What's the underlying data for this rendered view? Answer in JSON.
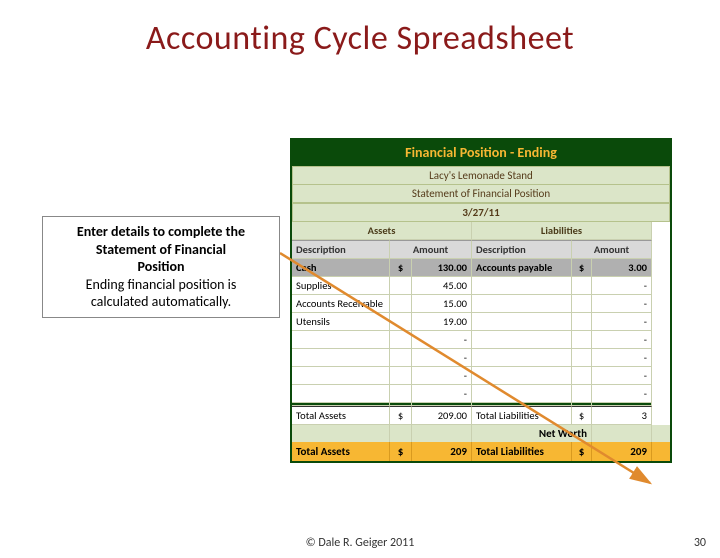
{
  "slide": {
    "title": "Accounting Cycle Spreadsheet",
    "footer": "© Dale R. Geiger 2011",
    "page_number": "30"
  },
  "callout": {
    "line1": "Enter details to complete the",
    "line2": "Statement of Financial",
    "line3": "Position",
    "line4": "Ending financial position is",
    "line5": "calculated automatically."
  },
  "sheet": {
    "banner": "Financial Position - Ending",
    "company": "Lacy's Lemonade Stand",
    "stmt": "Statement of Financial Position",
    "date": "3/27/11",
    "headers": {
      "assets": "Assets",
      "liabilities": "Liabilities",
      "desc": "Description",
      "amount": "Amount"
    },
    "rows": [
      {
        "adesc": "Cash",
        "acur": "$",
        "aval": "130.00",
        "ldesc": "Accounts payable",
        "lcur": "$",
        "lval": "3.00"
      },
      {
        "adesc": "Supplies",
        "acur": "",
        "aval": "45.00",
        "ldesc": "",
        "lcur": "",
        "lval": "-"
      },
      {
        "adesc": "Accounts Receivable",
        "acur": "",
        "aval": "15.00",
        "ldesc": "",
        "lcur": "",
        "lval": "-"
      },
      {
        "adesc": "Utensils",
        "acur": "",
        "aval": "19.00",
        "ldesc": "",
        "lcur": "",
        "lval": "-"
      },
      {
        "adesc": "",
        "acur": "",
        "aval": "-",
        "ldesc": "",
        "lcur": "",
        "lval": "-"
      },
      {
        "adesc": "",
        "acur": "",
        "aval": "-",
        "ldesc": "",
        "lcur": "",
        "lval": "-"
      },
      {
        "adesc": "",
        "acur": "",
        "aval": "-",
        "ldesc": "",
        "lcur": "",
        "lval": "-"
      },
      {
        "adesc": "",
        "acur": "",
        "aval": "-",
        "ldesc": "",
        "lcur": "",
        "lval": "-"
      }
    ],
    "totals": {
      "assets_label": "Total Assets",
      "assets_cur": "$",
      "assets_val": "209.00",
      "liab_label": "Total Liabilities",
      "liab_cur": "$",
      "liab_val": "3"
    },
    "networth": {
      "label": "Net Worth"
    },
    "orange": {
      "a_label": "Total Assets",
      "a_cur": "$",
      "a_val": "209",
      "l_label": "Total Liabilities",
      "l_cur": "$",
      "l_val": "209"
    }
  }
}
